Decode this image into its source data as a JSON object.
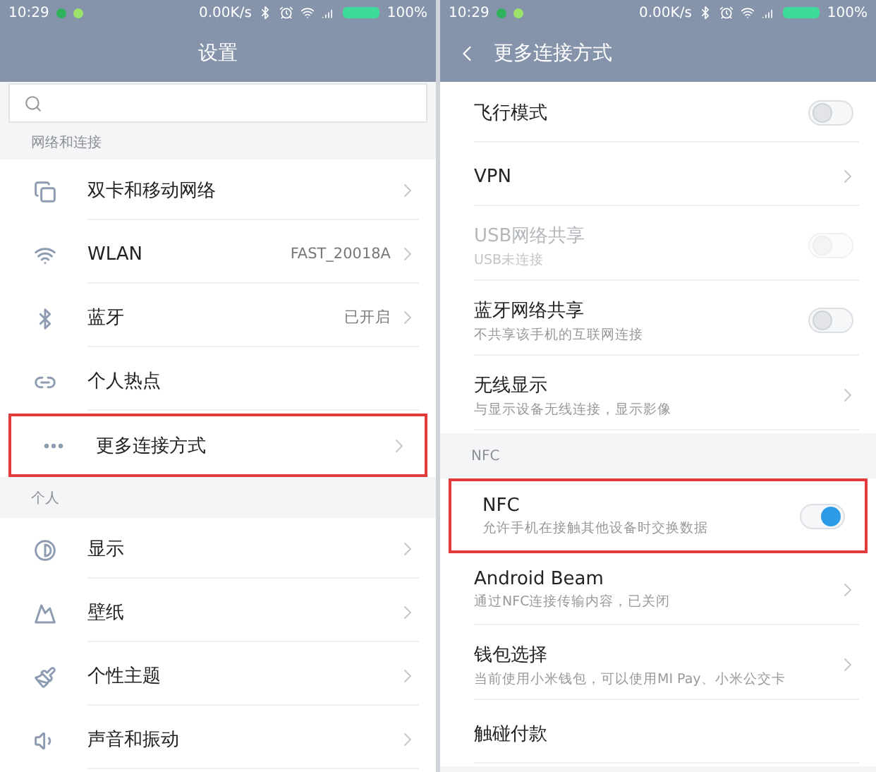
{
  "phones": [
    {
      "status_bar": {
        "time": "10:29",
        "speed": "0.00K/s",
        "battery": "100%"
      },
      "header": {
        "title": "设置",
        "back": false
      },
      "search": {
        "present": true
      },
      "sections": [
        {
          "label": "网络和连接",
          "items": [
            {
              "kind": "link",
              "title": "双卡和移动网络",
              "highlighted": false
            },
            {
              "kind": "link",
              "title": "WLAN",
              "value": "FAST_20018A",
              "highlighted": false
            },
            {
              "kind": "link",
              "title": "蓝牙",
              "value": "已开启",
              "highlighted": false
            },
            {
              "kind": "plain",
              "title": "个人热点",
              "highlighted": false
            },
            {
              "kind": "link",
              "title": "更多连接方式",
              "highlighted": true
            }
          ]
        },
        {
          "label": "个人",
          "items": [
            {
              "kind": "link",
              "title": "显示",
              "highlighted": false
            },
            {
              "kind": "link",
              "title": "壁纸",
              "highlighted": false
            },
            {
              "kind": "link",
              "title": "个性主题",
              "highlighted": false
            },
            {
              "kind": "link",
              "title": "声音和振动",
              "highlighted": false
            }
          ]
        }
      ]
    },
    {
      "status_bar": {
        "time": "10:29",
        "speed": "0.00K/s",
        "battery": "100%"
      },
      "header": {
        "title": "更多连接方式",
        "back": true
      },
      "sections": [
        {
          "items": [
            {
              "kind": "toggle",
              "title": "飞行模式",
              "on": false,
              "disabled": false,
              "highlighted": false
            },
            {
              "kind": "link",
              "title": "VPN",
              "highlighted": false
            },
            {
              "kind": "toggle",
              "title": "USB网络共享",
              "subtitle": "USB未连接",
              "on": false,
              "disabled": true,
              "highlighted": false
            },
            {
              "kind": "toggle",
              "title": "蓝牙网络共享",
              "subtitle": "不共享该手机的互联网连接",
              "on": false,
              "disabled": false,
              "highlighted": false
            },
            {
              "kind": "link",
              "title": "无线显示",
              "subtitle": "与显示设备无线连接，显示影像",
              "highlighted": false
            }
          ]
        },
        {
          "label": "NFC",
          "items": [
            {
              "kind": "toggle",
              "title": "NFC",
              "subtitle": "允许手机在接触其他设备时交换数据",
              "on": true,
              "disabled": false,
              "highlighted": true
            },
            {
              "kind": "link",
              "title": "Android Beam",
              "subtitle": "通过NFC连接传输内容，已关闭",
              "highlighted": false
            },
            {
              "kind": "link",
              "title": "钱包选择",
              "subtitle": "当前使用小米钱包，可以使用MI Pay、小米公交卡",
              "highlighted": false
            },
            {
              "kind": "plain",
              "title": "触碰付款",
              "highlighted": false
            }
          ]
        }
      ]
    }
  ]
}
